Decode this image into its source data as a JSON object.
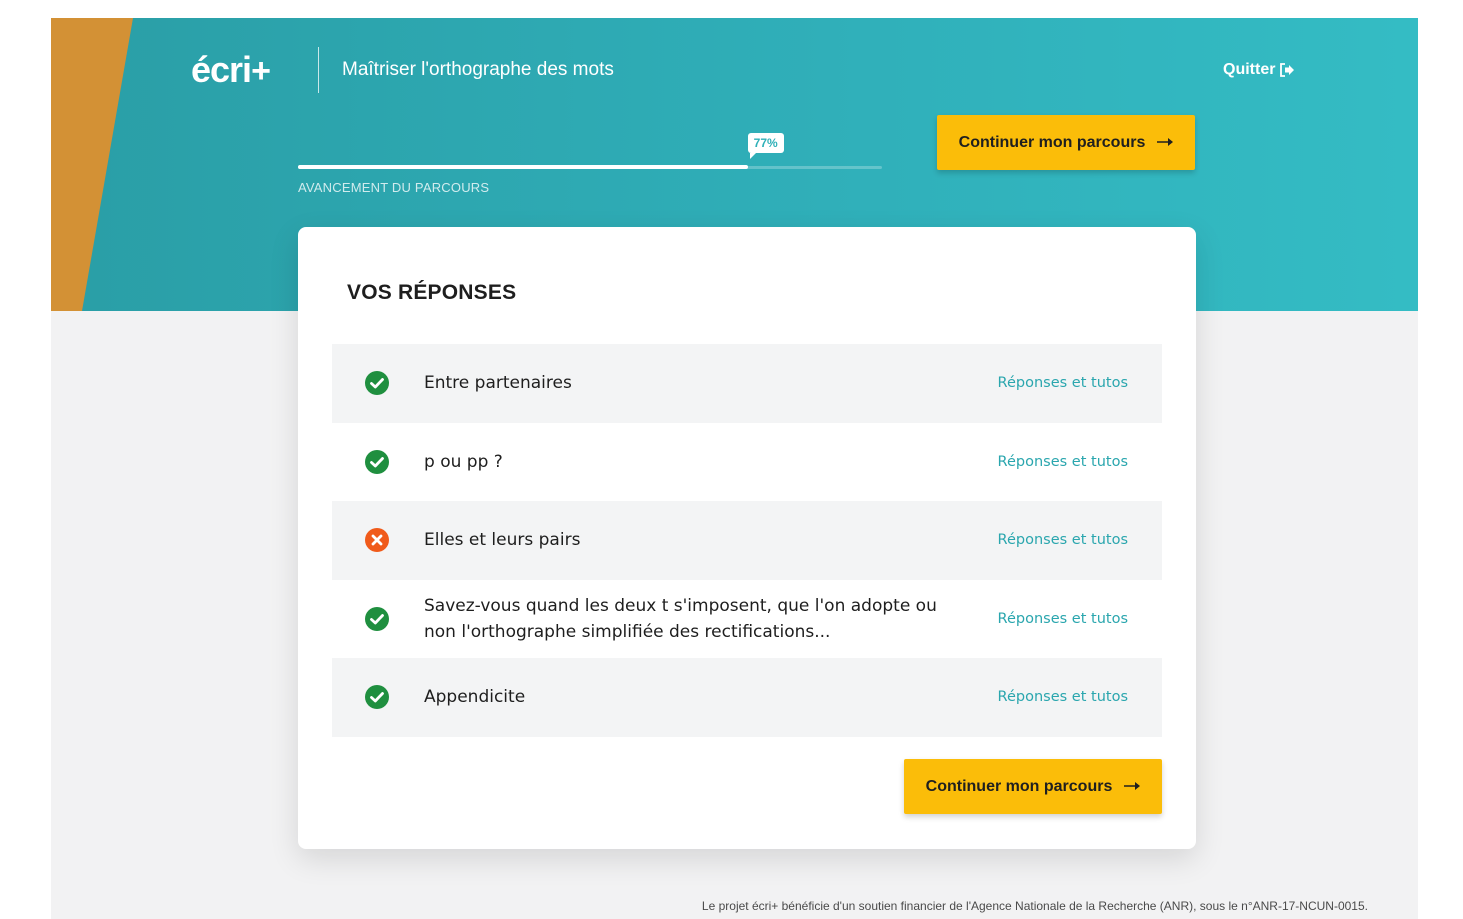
{
  "header": {
    "logo_main": "écri",
    "logo_plus": "+",
    "subtitle": "Maîtriser l'orthographe des mots",
    "quit_label": "Quitter"
  },
  "progress": {
    "percent_label": "77%",
    "value": 0.77,
    "caption": "AVANCEMENT DU PARCOURS"
  },
  "continue_label": "Continuer mon parcours",
  "answers": {
    "title": "VOS RÉPONSES",
    "link_label": "Réponses et tutos",
    "items": [
      {
        "label": "Entre partenaires",
        "status": "correct"
      },
      {
        "label": "p ou pp ?",
        "status": "correct"
      },
      {
        "label": "Elles et leurs pairs",
        "status": "incorrect"
      },
      {
        "label": "Savez-vous quand les deux t s'imposent, que l'on adopte ou non l'orthographe simplifiée des rectifications...",
        "status": "correct"
      },
      {
        "label": "Appendicite",
        "status": "correct"
      }
    ]
  },
  "footer": {
    "text": "Le projet écri+ bénéficie d'un soutien financier de l'Agence Nationale de la Recherche (ANR), sous le n°ANR-17-NCUN-0015."
  },
  "colors": {
    "accent": "#2fb0b8",
    "button": "#fbbd09",
    "correct": "#1f8f3f",
    "incorrect": "#f05a1a",
    "stripe": "#d39135"
  }
}
